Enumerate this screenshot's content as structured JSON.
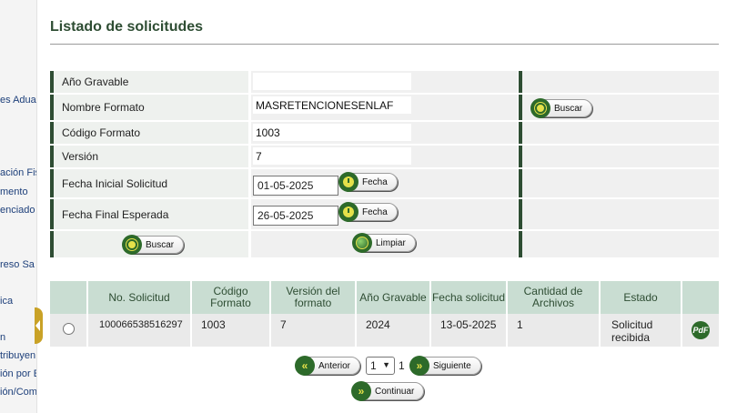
{
  "sidebar": {
    "items": [
      "es Aduar",
      "ación Fis",
      "mento",
      "enciado",
      "reso Sa",
      "ica",
      "n",
      "tribuyen",
      "ión por E",
      "ión/Com"
    ]
  },
  "page_title": "Listado de solicitudes",
  "form": {
    "anio_label": "Año Gravable",
    "anio_value": "",
    "nombre_label": "Nombre Formato",
    "nombre_value": "MASRETENCIONESENLAF",
    "codigo_label": "Código Formato",
    "codigo_value": "1003",
    "version_label": "Versión",
    "version_value": "7",
    "fecha_inicial_label": "Fecha Inicial Solicitud",
    "fecha_inicial_value": "01-05-2025",
    "fecha_final_label": "Fecha Final Esperada",
    "fecha_final_value": "26-05-2025",
    "fecha_button": "Fecha",
    "buscar_button": "Buscar",
    "limpiar_button": "Limpiar"
  },
  "results": {
    "headers": [
      "",
      "No. Solicitud",
      "Código Formato",
      "Versión del formato",
      "Año Gravable",
      "Fecha solicitud",
      "Cantidad de Archivos",
      "Estado",
      ""
    ],
    "rows": [
      {
        "no_solicitud": "100066538516297",
        "codigo": "1003",
        "version": "7",
        "anio": "2024",
        "fecha": "13-05-2025",
        "cantidad": "1",
        "estado": "Solicitud recibida",
        "pdf_icon": "PdF"
      }
    ]
  },
  "pagination": {
    "anterior": "Anterior",
    "siguiente": "Siguiente",
    "continuar": "Continuar",
    "selected_page": "1",
    "total_pages": "1"
  },
  "colors": {
    "accent_dark_green": "#2e4d33",
    "header_green": "#c9ddd2",
    "icon_green": "#2d6a2a",
    "icon_yellow": "#e5e14a"
  }
}
